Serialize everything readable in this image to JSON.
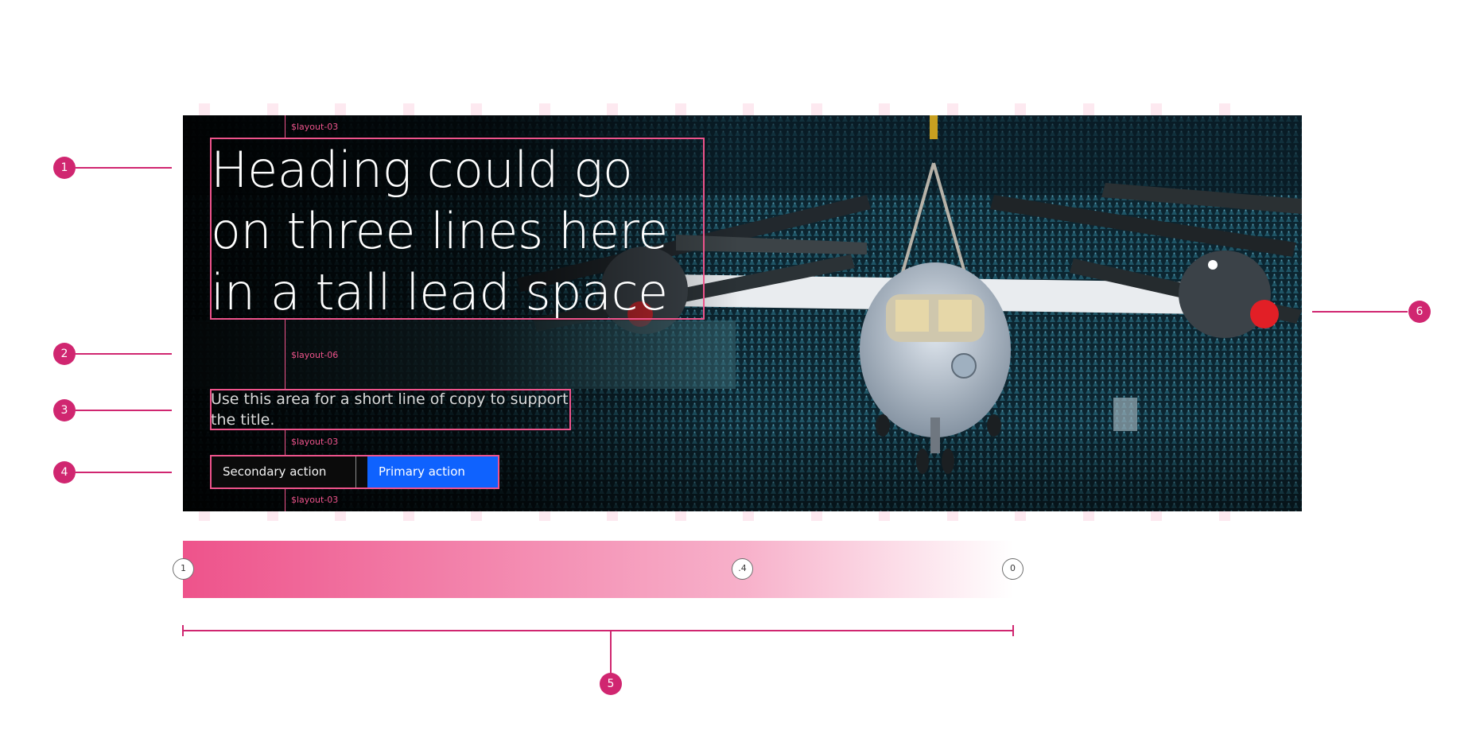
{
  "colors": {
    "annotation": "#d02670",
    "guide": "#ee538b",
    "primary_button": "#0f62fe",
    "background": "#ffffff"
  },
  "lead_space": {
    "heading": "Heading could go on three lines here in a tall lead space",
    "copy": "Use this area for a short line of copy to support the title.",
    "secondary_button": "Secondary action",
    "primary_button": "Primary action",
    "image_icon": "aircraft-in-hangar-image"
  },
  "spacing_tokens": {
    "top": "$layout-03",
    "heading_to_copy": "$layout-06",
    "copy_to_buttons": "$layout-03",
    "bottom": "$layout-03"
  },
  "gradient": {
    "stops": [
      "1",
      ".4",
      "0"
    ]
  },
  "callouts": [
    "1",
    "2",
    "3",
    "4",
    "5",
    "6"
  ]
}
